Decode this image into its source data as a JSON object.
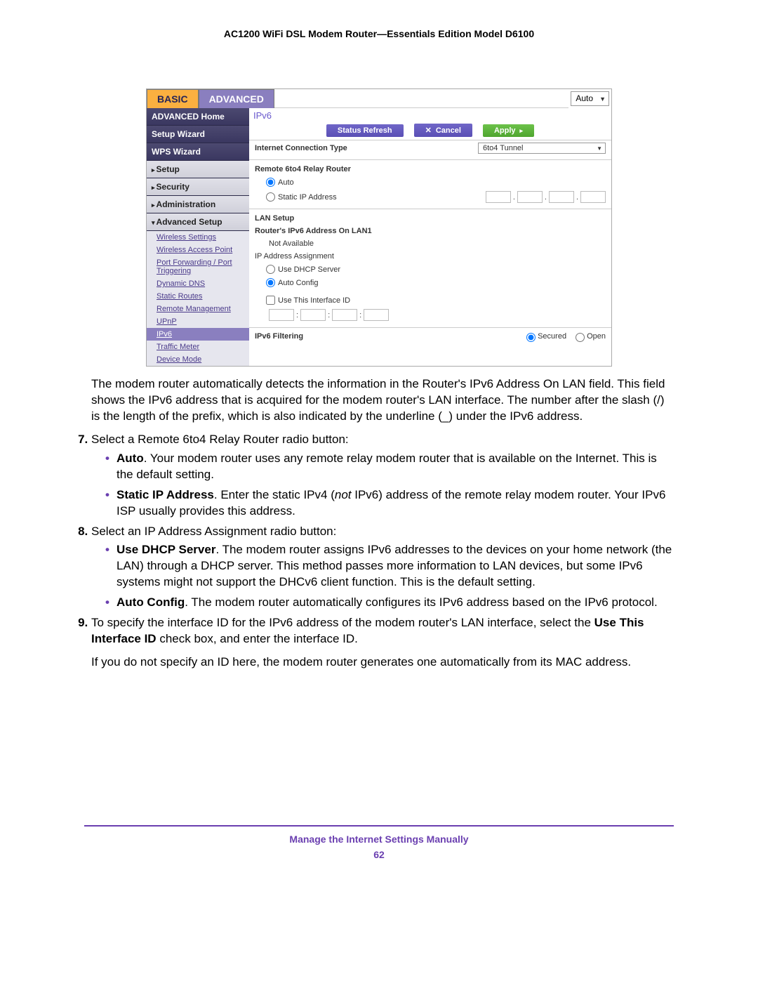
{
  "header_title": "AC1200 WiFi DSL Modem Router—Essentials Edition Model D6100",
  "ui": {
    "top_select": "Auto",
    "tab_basic": "BASIC",
    "tab_adv": "ADVANCED",
    "sidebar": {
      "adv_home": "ADVANCED Home",
      "setup_wizard": "Setup Wizard",
      "wps_wizard": "WPS Wizard",
      "setup": "Setup",
      "security": "Security",
      "administration": "Administration",
      "advanced_setup": "Advanced Setup",
      "sub": {
        "wireless_settings": "Wireless Settings",
        "wap": "Wireless Access Point",
        "pf": "Port Forwarding / Port Triggering",
        "ddns": "Dynamic DNS",
        "static_routes": "Static Routes",
        "remote_mgmt": "Remote Management",
        "upnp": "UPnP",
        "ipv6": "IPv6",
        "traffic": "Traffic Meter",
        "device_mode": "Device Mode"
      }
    },
    "content": {
      "title": "IPv6",
      "btn_refresh": "Status Refresh",
      "btn_cancel": "Cancel",
      "btn_apply": "Apply",
      "ict_label": "Internet Connection Type",
      "ict_value": "6to4 Tunnel",
      "relay_header": "Remote 6to4 Relay Router",
      "opt_auto": "Auto",
      "opt_static": "Static IP Address",
      "lan_header": "LAN Setup",
      "lan_addr_label": "Router's IPv6 Address On LAN1",
      "lan_addr_val": "Not Available",
      "ip_assign_label": "IP Address Assignment",
      "opt_dhcp": "Use DHCP Server",
      "opt_autocfg": "Auto Config",
      "use_iface": "Use This Interface ID",
      "filter_label": "IPv6 Filtering",
      "filter_secured": "Secured",
      "filter_open": "Open"
    }
  },
  "body": {
    "para1": "The modem router automatically detects the information in the Router's IPv6 Address On LAN field. This field shows the IPv6 address that is acquired for the modem router's LAN interface. The number after the slash (/) is the length of the prefix, which is also indicated by the underline (_) under the IPv6 address.",
    "s7": "Select a Remote 6to4 Relay Router radio button:",
    "s7a_b": "Auto",
    "s7a": ". Your modem router uses any remote relay modem router that is available on the Internet. This is the default setting.",
    "s7b_b": "Static IP Address",
    "s7b_1": ". Enter the static IPv4 (",
    "s7b_i": "not",
    "s7b_2": " IPv6) address of the remote relay modem router. Your IPv6 ISP usually provides this address.",
    "s8": "Select an IP Address Assignment radio button:",
    "s8a_b": "Use DHCP Server",
    "s8a": ". The modem router assigns IPv6 addresses to the devices on your home network (the LAN) through a DHCP server. This method passes more information to LAN devices, but some IPv6 systems might not support the DHCv6 client function. This is the default setting.",
    "s8b_b": "Auto Config",
    "s8b": ". The modem router automatically configures its IPv6 address based on the IPv6 protocol.",
    "s9_1": "To specify the interface ID for the IPv6 address of the modem router's LAN interface, select the ",
    "s9_b": "Use This Interface ID",
    "s9_2": " check box, and enter the interface ID.",
    "s9_p": "If you do not specify an ID here, the modem router generates one automatically from its MAC address."
  },
  "footer": {
    "section": "Manage the Internet Settings Manually",
    "page": "62"
  }
}
